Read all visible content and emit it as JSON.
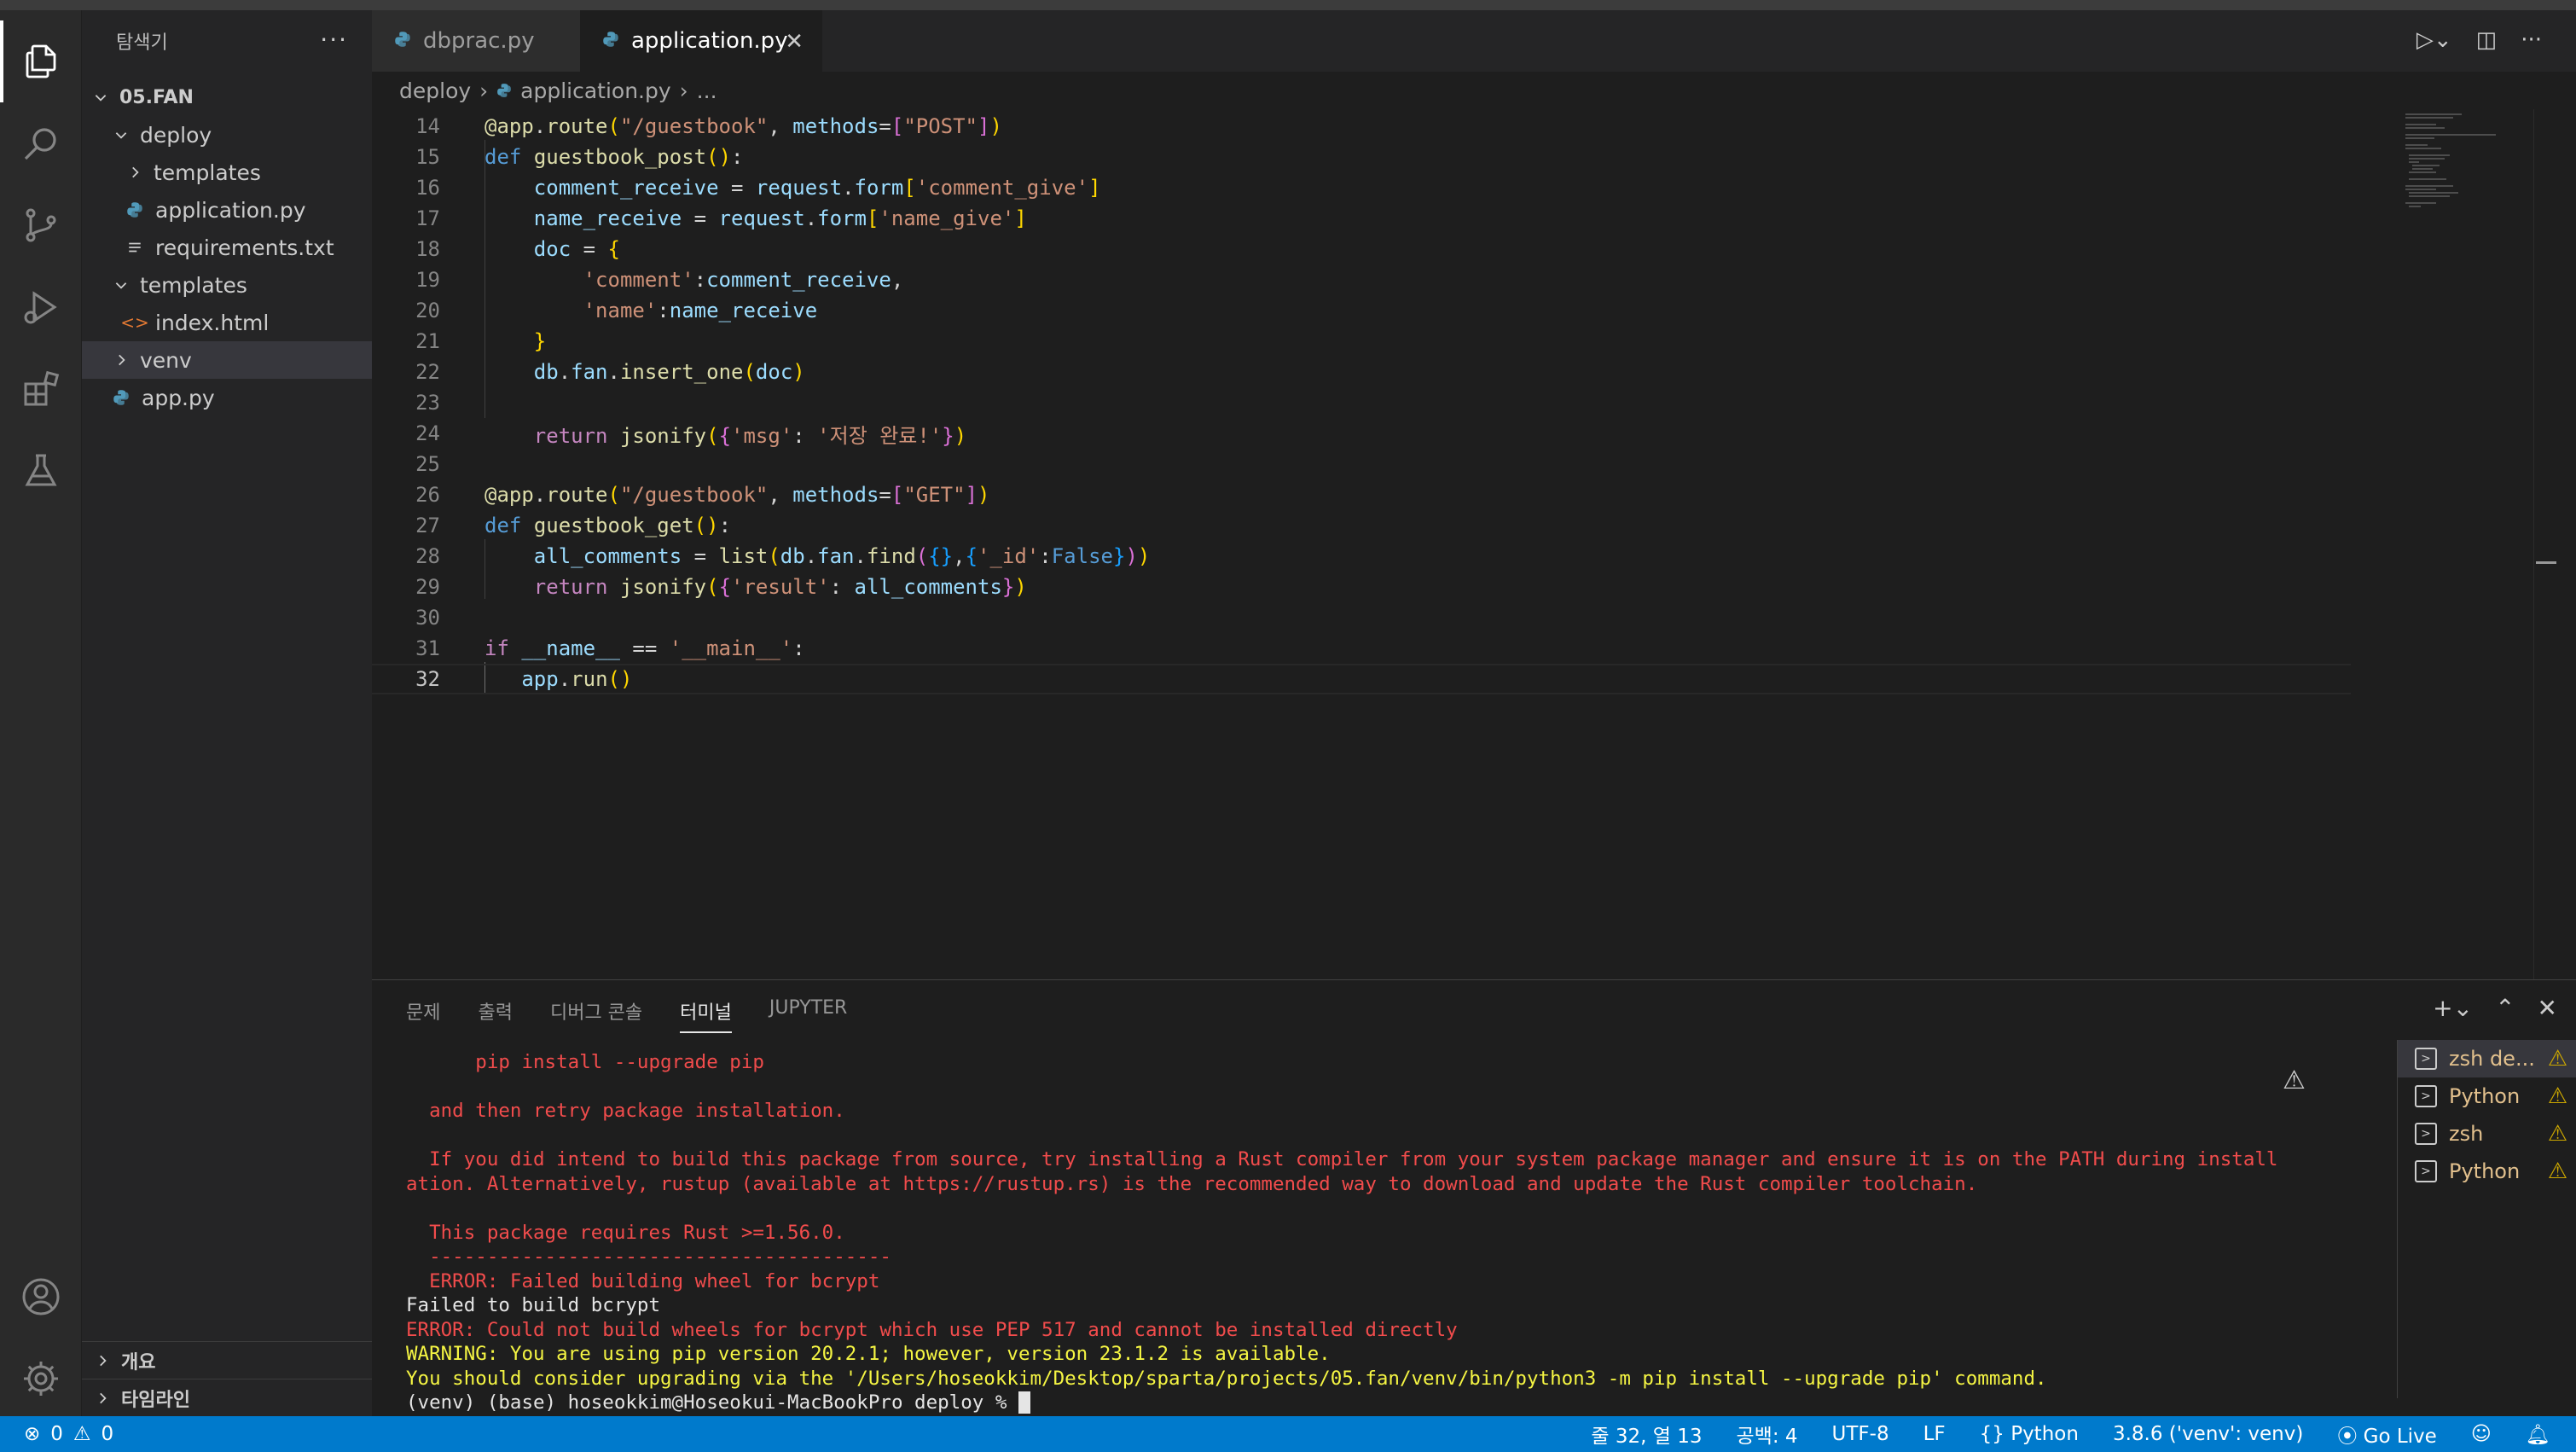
{
  "sidebar": {
    "title": "탐색기",
    "root": "05.FAN",
    "items": [
      {
        "label": "deploy",
        "kind": "folder-open",
        "depth": 1
      },
      {
        "label": "templates",
        "kind": "folder-closed",
        "depth": 2
      },
      {
        "label": "application.py",
        "kind": "python",
        "depth": 2
      },
      {
        "label": "requirements.txt",
        "kind": "text",
        "depth": 2
      },
      {
        "label": "templates",
        "kind": "folder-open",
        "depth": 1
      },
      {
        "label": "index.html",
        "kind": "html",
        "depth": 2
      },
      {
        "label": "venv",
        "kind": "folder-closed",
        "depth": 1
      },
      {
        "label": "app.py",
        "kind": "python",
        "depth": 1
      }
    ],
    "outline": "개요",
    "timeline": "타임라인"
  },
  "tabs": [
    {
      "label": "dbprac.py",
      "active": false
    },
    {
      "label": "application.py",
      "active": true
    }
  ],
  "breadcrumb": {
    "folder": "deploy",
    "file": "application.py",
    "rest": "..."
  },
  "editor": {
    "lines": [
      {
        "n": "14",
        "t": "@app.route(\"/guestbook\", methods=[\"POST\"])"
      },
      {
        "n": "15",
        "t": "def guestbook_post():"
      },
      {
        "n": "16",
        "t": "    comment_receive = request.form['comment_give']"
      },
      {
        "n": "17",
        "t": "    name_receive = request.form['name_give']"
      },
      {
        "n": "18",
        "t": "    doc = {"
      },
      {
        "n": "19",
        "t": "        'comment':comment_receive,"
      },
      {
        "n": "20",
        "t": "        'name':name_receive"
      },
      {
        "n": "21",
        "t": "    }"
      },
      {
        "n": "22",
        "t": "    db.fan.insert_one(doc)"
      },
      {
        "n": "23",
        "t": ""
      },
      {
        "n": "24",
        "t": "    return jsonify({'msg': '저장 완료!'})"
      },
      {
        "n": "25",
        "t": ""
      },
      {
        "n": "26",
        "t": "@app.route(\"/guestbook\", methods=[\"GET\"])"
      },
      {
        "n": "27",
        "t": "def guestbook_get():"
      },
      {
        "n": "28",
        "t": "    all_comments = list(db.fan.find({},{'_id':False}))"
      },
      {
        "n": "29",
        "t": "    return jsonify({'result': all_comments})"
      },
      {
        "n": "30",
        "t": ""
      },
      {
        "n": "31",
        "t": "if __name__ == '__main__':"
      },
      {
        "n": "32",
        "t": "   app.run()"
      }
    ],
    "current_line": "32"
  },
  "panel": {
    "tabs": [
      "문제",
      "출력",
      "디버그 콘솔",
      "터미널",
      "JUPYTER"
    ],
    "active_tab": "터미널",
    "terminal_lines": [
      {
        "text": "      pip install --upgrade pip",
        "color": "red"
      },
      {
        "text": "",
        "color": "red"
      },
      {
        "text": "  and then retry package installation.",
        "color": "red"
      },
      {
        "text": "",
        "color": "red"
      },
      {
        "text": "  If you did intend to build this package from source, try installing a Rust compiler from your system package manager and ensure it is on the PATH during install",
        "color": "red"
      },
      {
        "text": "ation. Alternatively, rustup (available at https://rustup.rs) is the recommended way to download and update the Rust compiler toolchain.",
        "color": "red"
      },
      {
        "text": "",
        "color": "red"
      },
      {
        "text": "  This package requires Rust >=1.56.0.",
        "color": "red"
      },
      {
        "text": "  ----------------------------------------",
        "color": "red"
      },
      {
        "text": "  ERROR: Failed building wheel for bcrypt",
        "color": "red"
      },
      {
        "text": "Failed to build bcrypt",
        "color": "white"
      },
      {
        "text": "ERROR: Could not build wheels for bcrypt which use PEP 517 and cannot be installed directly",
        "color": "red"
      },
      {
        "text": "WARNING: You are using pip version 20.2.1; however, version 23.1.2 is available.",
        "color": "yellow"
      },
      {
        "text": "You should consider upgrading via the '/Users/hoseokkim/Desktop/sparta/projects/05.fan/venv/bin/python3 -m pip install --upgrade pip' command.",
        "color": "yellow"
      },
      {
        "text": "(venv) (base) hoseokkim@Hoseokui-MacBookPro deploy % ",
        "color": "white"
      }
    ],
    "terminals": [
      {
        "label": "zsh de...",
        "active": true
      },
      {
        "label": "Python",
        "active": false
      },
      {
        "label": "zsh",
        "active": false
      },
      {
        "label": "Python",
        "active": false
      }
    ]
  },
  "statusbar": {
    "errors": "0",
    "warnings": "0",
    "position": "줄 32, 열 13",
    "spaces": "공백: 4",
    "encoding": "UTF-8",
    "eol": "LF",
    "language": "Python",
    "interpreter": "3.8.6 ('venv': venv)",
    "golive": "Go Live"
  }
}
